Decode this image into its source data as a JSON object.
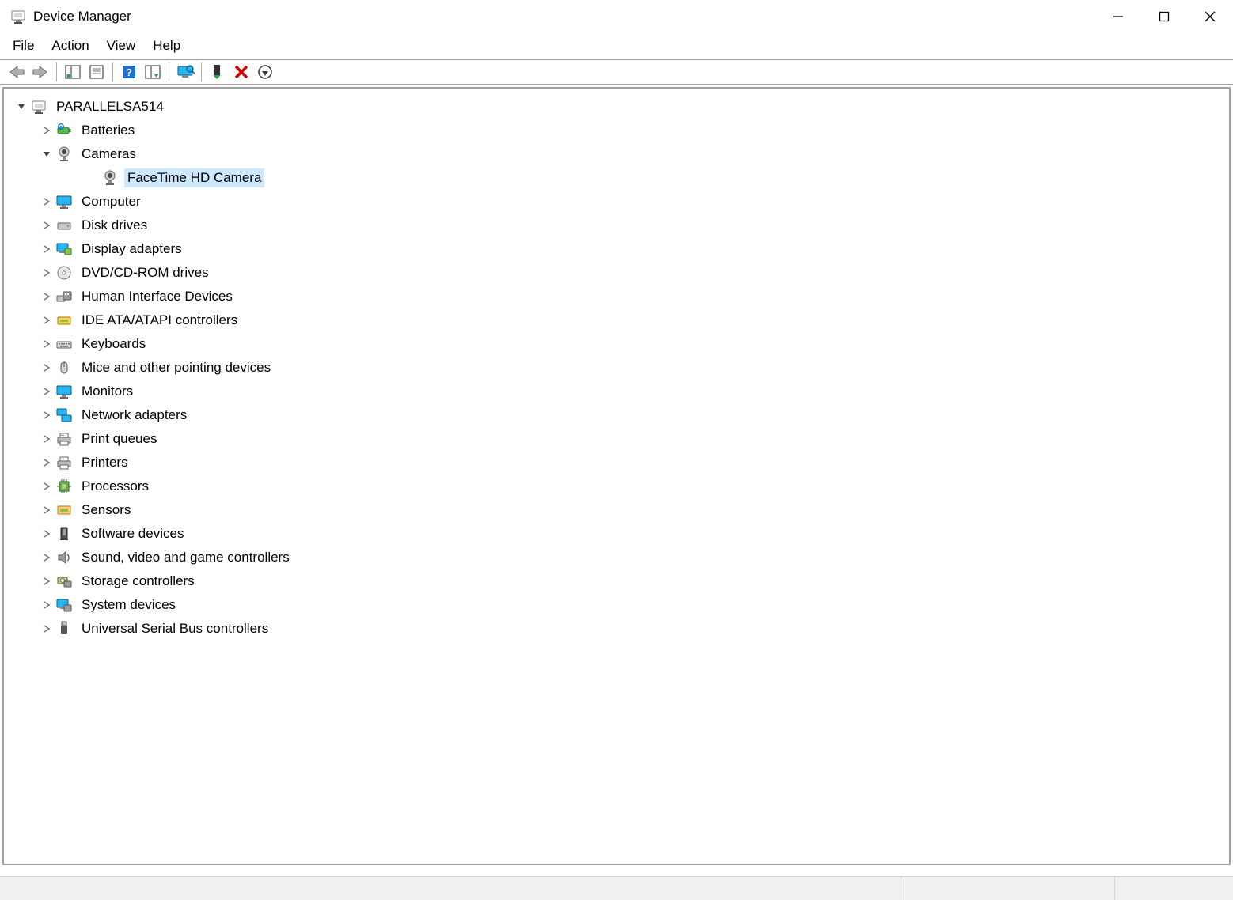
{
  "window": {
    "title": "Device Manager"
  },
  "menu": {
    "file": "File",
    "action": "Action",
    "view": "View",
    "help": "Help"
  },
  "tree": {
    "root": {
      "label": "PARALLELSA514",
      "expanded": true
    },
    "batteries": {
      "label": "Batteries"
    },
    "cameras": {
      "label": "Cameras",
      "expanded": true
    },
    "facetime": {
      "label": "FaceTime HD Camera",
      "selected": true
    },
    "computer": {
      "label": "Computer"
    },
    "disk": {
      "label": "Disk drives"
    },
    "display": {
      "label": "Display adapters"
    },
    "dvd": {
      "label": "DVD/CD-ROM drives"
    },
    "hid": {
      "label": "Human Interface Devices"
    },
    "ide": {
      "label": "IDE ATA/ATAPI controllers"
    },
    "keyboards": {
      "label": "Keyboards"
    },
    "mice": {
      "label": "Mice and other pointing devices"
    },
    "monitors": {
      "label": "Monitors"
    },
    "network": {
      "label": "Network adapters"
    },
    "printq": {
      "label": "Print queues"
    },
    "printers": {
      "label": "Printers"
    },
    "processors": {
      "label": "Processors"
    },
    "sensors": {
      "label": "Sensors"
    },
    "software": {
      "label": "Software devices"
    },
    "sound": {
      "label": "Sound, video and game controllers"
    },
    "storage": {
      "label": "Storage controllers"
    },
    "system": {
      "label": "System devices"
    },
    "usb": {
      "label": "Universal Serial Bus controllers"
    }
  }
}
